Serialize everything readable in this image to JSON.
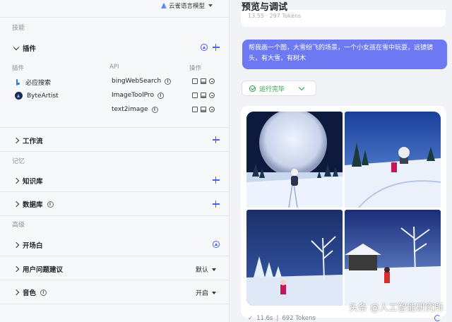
{
  "model": {
    "name": "云雀语言模型"
  },
  "sections": {
    "skills": "技能",
    "memory": "记忆",
    "advanced": "高级"
  },
  "plugins": {
    "title": "插件",
    "col_plugin": "插件",
    "col_api": "API",
    "col_ops": "操作",
    "items": [
      {
        "name": "必应搜索",
        "api": "bingWebSearch"
      },
      {
        "name": "ByteArtist",
        "api": "ImageToolPro"
      },
      {
        "name": "",
        "api": "text2image"
      }
    ]
  },
  "workflow": {
    "title": "工作流"
  },
  "knowledge": {
    "title": "知识库"
  },
  "database": {
    "title": "数据库"
  },
  "opening": {
    "title": "开场白"
  },
  "suggestions": {
    "title": "用户问题建议",
    "value": "默认"
  },
  "voice": {
    "title": "音色",
    "value": "开启"
  },
  "preview": {
    "title": "预览与调试",
    "prev_meta": "13.55 · 297 Tokens",
    "user_message": "帮我画一个图，大雪纷飞的场景，一个小女孩在雪中玩耍，远镜镜头，有大雪，有树木",
    "status": "运行完毕",
    "duration": "11.6s",
    "tokens": "692 Tokens"
  },
  "watermark": "头条 @人工智能研究所",
  "colors": {
    "accent": "#4b5eff",
    "bubble": "#6c79f2",
    "success": "#2a9a4a"
  }
}
